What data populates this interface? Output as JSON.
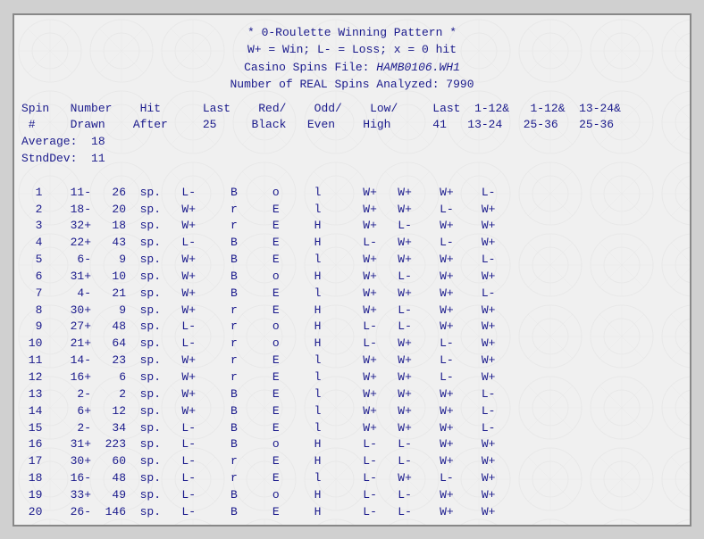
{
  "header": {
    "line1": "* 0-Roulette Winning Pattern *",
    "line2": "W+ = Win; L- = Loss; x = 0 hit",
    "line3_prefix": "Casino Spins File: ",
    "line3_italic": "HAMB0106.WH1",
    "line4": "Number of REAL Spins Analyzed: 7990"
  },
  "col_headers_line1": "Spin    Number    Hit      Last    Red/     Odd/    Low/      Last  1-12&   1-12&  13-24&",
  "col_headers_line2": " #      Drawn    After     25    Black    Even    High       41   13-24   25-36   25-36",
  "stats": {
    "average_label": "Average:",
    "average_val": "18",
    "stddev_label": "StndDev:",
    "stddev_val": "11"
  },
  "rows": [
    {
      "spin": "1",
      "num": "11-",
      "hit": "26",
      "sp": "sp.",
      "last": "L-",
      "rb": "B",
      "oe": "o",
      "lh": "l",
      "last41": "W+",
      "c1": "W+",
      "c2": "W+",
      "c3": "L-"
    },
    {
      "spin": "2",
      "num": "18-",
      "hit": "20",
      "sp": "sp.",
      "last": "W+",
      "rb": "r",
      "oe": "E",
      "lh": "l",
      "last41": "W+",
      "c1": "W+",
      "c2": "L-",
      "c3": "W+"
    },
    {
      "spin": "3",
      "num": "32+",
      "hit": "18",
      "sp": "sp.",
      "last": "W+",
      "rb": "r",
      "oe": "E",
      "lh": "H",
      "last41": "W+",
      "c1": "L-",
      "c2": "W+",
      "c3": "W+"
    },
    {
      "spin": "4",
      "num": "22+",
      "hit": "43",
      "sp": "sp.",
      "last": "L-",
      "rb": "B",
      "oe": "E",
      "lh": "H",
      "last41": "L-",
      "c1": "W+",
      "c2": "L-",
      "c3": "W+"
    },
    {
      "spin": "5",
      "num": "6-",
      "hit": "9",
      "sp": "sp.",
      "last": "W+",
      "rb": "B",
      "oe": "E",
      "lh": "l",
      "last41": "W+",
      "c1": "W+",
      "c2": "W+",
      "c3": "L-"
    },
    {
      "spin": "6",
      "num": "31+",
      "hit": "10",
      "sp": "sp.",
      "last": "W+",
      "rb": "B",
      "oe": "o",
      "lh": "H",
      "last41": "W+",
      "c1": "L-",
      "c2": "W+",
      "c3": "W+"
    },
    {
      "spin": "7",
      "num": "4-",
      "hit": "21",
      "sp": "sp.",
      "last": "W+",
      "rb": "B",
      "oe": "E",
      "lh": "l",
      "last41": "W+",
      "c1": "W+",
      "c2": "W+",
      "c3": "L-"
    },
    {
      "spin": "8",
      "num": "30+",
      "hit": "9",
      "sp": "sp.",
      "last": "W+",
      "rb": "r",
      "oe": "E",
      "lh": "H",
      "last41": "W+",
      "c1": "L-",
      "c2": "W+",
      "c3": "W+"
    },
    {
      "spin": "9",
      "num": "27+",
      "hit": "48",
      "sp": "sp.",
      "last": "L-",
      "rb": "r",
      "oe": "o",
      "lh": "H",
      "last41": "L-",
      "c1": "L-",
      "c2": "W+",
      "c3": "W+"
    },
    {
      "spin": "10",
      "num": "21+",
      "hit": "64",
      "sp": "sp.",
      "last": "L-",
      "rb": "r",
      "oe": "o",
      "lh": "H",
      "last41": "L-",
      "c1": "W+",
      "c2": "L-",
      "c3": "W+"
    },
    {
      "spin": "11",
      "num": "14-",
      "hit": "23",
      "sp": "sp.",
      "last": "W+",
      "rb": "r",
      "oe": "E",
      "lh": "l",
      "last41": "W+",
      "c1": "W+",
      "c2": "L-",
      "c3": "W+"
    },
    {
      "spin": "12",
      "num": "16+",
      "hit": "6",
      "sp": "sp.",
      "last": "W+",
      "rb": "r",
      "oe": "E",
      "lh": "l",
      "last41": "W+",
      "c1": "W+",
      "c2": "L-",
      "c3": "W+"
    },
    {
      "spin": "13",
      "num": "2-",
      "hit": "2",
      "sp": "sp.",
      "last": "W+",
      "rb": "B",
      "oe": "E",
      "lh": "l",
      "last41": "W+",
      "c1": "W+",
      "c2": "W+",
      "c3": "L-"
    },
    {
      "spin": "14",
      "num": "6+",
      "hit": "12",
      "sp": "sp.",
      "last": "W+",
      "rb": "B",
      "oe": "E",
      "lh": "l",
      "last41": "W+",
      "c1": "W+",
      "c2": "W+",
      "c3": "L-"
    },
    {
      "spin": "15",
      "num": "2-",
      "hit": "34",
      "sp": "sp.",
      "last": "L-",
      "rb": "B",
      "oe": "E",
      "lh": "l",
      "last41": "W+",
      "c1": "W+",
      "c2": "W+",
      "c3": "L-"
    },
    {
      "spin": "16",
      "num": "31+",
      "hit": "223",
      "sp": "sp.",
      "last": "L-",
      "rb": "B",
      "oe": "o",
      "lh": "H",
      "last41": "L-",
      "c1": "L-",
      "c2": "W+",
      "c3": "W+"
    },
    {
      "spin": "17",
      "num": "30+",
      "hit": "60",
      "sp": "sp.",
      "last": "L-",
      "rb": "r",
      "oe": "E",
      "lh": "H",
      "last41": "L-",
      "c1": "L-",
      "c2": "W+",
      "c3": "W+"
    },
    {
      "spin": "18",
      "num": "16-",
      "hit": "48",
      "sp": "sp.",
      "last": "L-",
      "rb": "r",
      "oe": "E",
      "lh": "l",
      "last41": "L-",
      "c1": "W+",
      "c2": "L-",
      "c3": "W+"
    },
    {
      "spin": "19",
      "num": "33+",
      "hit": "49",
      "sp": "sp.",
      "last": "L-",
      "rb": "B",
      "oe": "o",
      "lh": "H",
      "last41": "L-",
      "c1": "L-",
      "c2": "W+",
      "c3": "W+"
    },
    {
      "spin": "20",
      "num": "26-",
      "hit": "146",
      "sp": "sp.",
      "last": "L-",
      "rb": "B",
      "oe": "E",
      "lh": "H",
      "last41": "L-",
      "c1": "L-",
      "c2": "W+",
      "c3": "W+"
    }
  ],
  "footer": "..."
}
